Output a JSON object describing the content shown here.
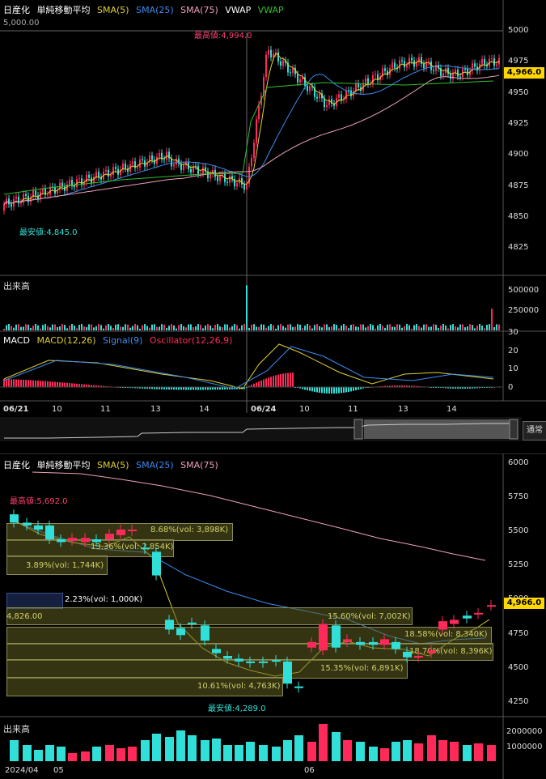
{
  "top_chart": {
    "header": {
      "name": "日産化",
      "indicator": "単純移動平均",
      "sma5": "SMA(5)",
      "sma25": "SMA(25)",
      "sma75": "SMA(75)",
      "vwap1": "VWAP",
      "vwap2": "VWAP"
    },
    "ref_price": "5,000.00",
    "price_ticks": [
      "5000",
      "4975",
      "4950",
      "4925",
      "4900",
      "4875",
      "4850",
      "4825"
    ],
    "current_price": "4,966.0",
    "high_label": "最高値:4,994.0",
    "low_label": "最安値:4,845.0",
    "volume": {
      "title": "出来高",
      "ticks": [
        "500000",
        "250000"
      ]
    },
    "macd": {
      "title": "MACD",
      "macd_label": "MACD(12,26)",
      "signal_label": "Signal(9)",
      "osc_label": "Oscillator(12,26,9)",
      "ticks": [
        "30",
        "20",
        "10",
        "0"
      ]
    },
    "dates": [
      "06/21",
      "10",
      "11",
      "13",
      "14",
      "06/24",
      "10",
      "11",
      "13",
      "14"
    ],
    "mode_button": "通常"
  },
  "bottom_chart": {
    "header": {
      "name": "日産化",
      "indicator": "単純移動平均",
      "sma5": "SMA(5)",
      "sma25": "SMA(25)",
      "sma75": "SMA(75)"
    },
    "price_ticks": [
      "6000",
      "5750",
      "5500",
      "5250",
      "5000",
      "4750",
      "4500",
      "4250"
    ],
    "current_price": "4,966.0",
    "high_label": "最高値:5,692.0",
    "low_label": "最安値:4,289.0",
    "boxes": [
      "8.68%(vol: 3,898K)",
      "13.36%(vol: 2,854K)",
      "3.89%(vol: 1,744K)",
      "2.23%(vol: 1,000K)",
      "4,826.00",
      "15.60%(vol: 7,002K)",
      "18.58%(vol: 8,340K)",
      "18.70%(vol: 8,396K)",
      "15.35%(vol: 6,891K)",
      "10.61%(vol: 4,763K)"
    ],
    "volume": {
      "title": "出来高",
      "ticks": [
        "2000000",
        "1000000"
      ]
    },
    "dates": [
      "2024/04",
      "05",
      "06"
    ]
  },
  "colors": {
    "up": "#ff2a5a",
    "down": "#30e0d8",
    "sma5": "#e0d030",
    "sma25": "#3c8cf0",
    "sma75": "#f0a0b8",
    "vwap": "#30c030",
    "price_tag": "#ffd700"
  }
}
